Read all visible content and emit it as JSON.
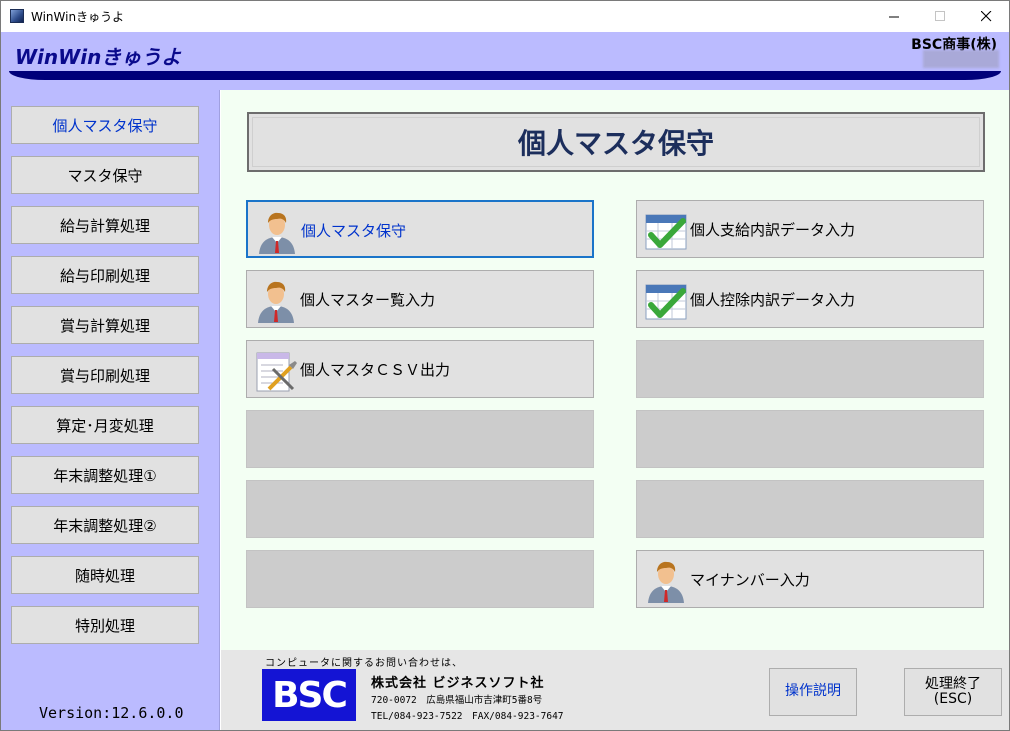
{
  "window": {
    "title": "WinWinきゅうよ"
  },
  "header": {
    "app_name": "WinWinきゅうよ",
    "company": "BSC商事(株)"
  },
  "sidebar": {
    "items": [
      {
        "label": "個人マスタ保守",
        "active": true
      },
      {
        "label": "マスタ保守"
      },
      {
        "label": "給与計算処理"
      },
      {
        "label": "給与印刷処理"
      },
      {
        "label": "賞与計算処理"
      },
      {
        "label": "賞与印刷処理"
      },
      {
        "label": "算定･月変処理"
      },
      {
        "label": "年末調整処理①"
      },
      {
        "label": "年末調整処理②"
      },
      {
        "label": "随時処理"
      },
      {
        "label": "特別処理"
      }
    ],
    "version": "Version:12.6.0.0"
  },
  "main": {
    "page_title": "個人マスタ保守",
    "left_buttons": [
      {
        "label": "個人マスタ保守",
        "icon": "person-icon",
        "focused": true
      },
      {
        "label": "個人マスター覧入力",
        "icon": "person-icon"
      },
      {
        "label": "個人マスタＣＳＶ出力",
        "icon": "csv-tools-icon"
      },
      {
        "label": ""
      },
      {
        "label": ""
      },
      {
        "label": ""
      }
    ],
    "right_buttons": [
      {
        "label": "個人支給内訳データ入力",
        "icon": "calendar-check-icon"
      },
      {
        "label": "個人控除内訳データ入力",
        "icon": "calendar-check-icon"
      },
      {
        "label": ""
      },
      {
        "label": ""
      },
      {
        "label": ""
      },
      {
        "label": "マイナンバー入力",
        "icon": "person-icon"
      }
    ]
  },
  "footer": {
    "contact_line": "コンピュータに関するお問い合わせは、",
    "logo_text": "BSC",
    "corp_name": "株式会社 ビジネスソフト社",
    "address": "720-0072　広島県福山市吉津町5番8号",
    "tel_fax": "TEL/084-923-7522　FAX/084-923-7647",
    "help_label": "操作説明",
    "exit_label_line1": "処理終了",
    "exit_label_line2": "(ESC)"
  },
  "colors": {
    "header_bg": "#bbbbff",
    "header_bar": "#00007a",
    "main_bg": "#f3fff3",
    "accent_blue": "#0033cc"
  }
}
